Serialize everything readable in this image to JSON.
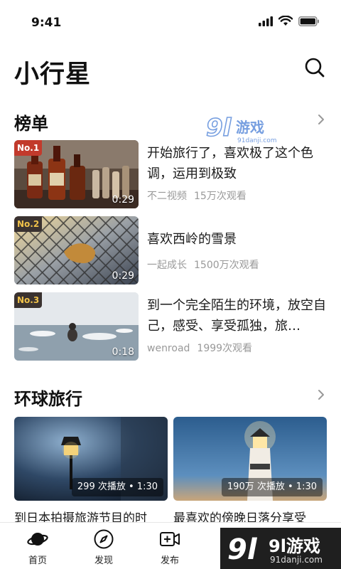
{
  "status": {
    "time": "9:41"
  },
  "app": {
    "title": "小行星"
  },
  "ranking": {
    "title": "榜单",
    "items": [
      {
        "badge": "No.1",
        "duration": "0:29",
        "title": "开始旅行了，喜欢极了这个色调，运用到极致",
        "author": "不二视频",
        "views": "15万次观看"
      },
      {
        "badge": "No.2",
        "duration": "0:29",
        "title": "喜欢西岭的雪景",
        "author": "一起成长",
        "views": "1500万次观看"
      },
      {
        "badge": "No.3",
        "duration": "0:18",
        "title": "到一个完全陌生的环境，放空自己，感受、享受孤独，旅…",
        "author": "wenroad",
        "views": "1999次观看"
      }
    ]
  },
  "travel": {
    "title": "环球旅行",
    "cards": [
      {
        "plays": "299 次播放",
        "duration": "1:30",
        "title": "到日本拍摄旅游节目的时"
      },
      {
        "plays": "190万 次播放",
        "duration": "1:30",
        "title": "最喜欢的傍晚日落分享受"
      }
    ]
  },
  "tabbar": {
    "tabs": [
      {
        "label": "首页",
        "icon": "planet-icon"
      },
      {
        "label": "发现",
        "icon": "compass-icon"
      },
      {
        "label": "发布",
        "icon": "video-add-icon"
      },
      {
        "label": "关",
        "icon": "glasses-icon"
      }
    ]
  },
  "watermark": {
    "brand": "9l游戏",
    "url": "91danji.com"
  },
  "colors": {
    "badge_no1_bg": "#c23a2c",
    "badge_no1_text": "#ffffff",
    "badge_other_bg": "#3a3230",
    "badge_other_text": "#f0c24a",
    "meta_text": "#999999",
    "watermark_blue": "#4a7fd6"
  }
}
